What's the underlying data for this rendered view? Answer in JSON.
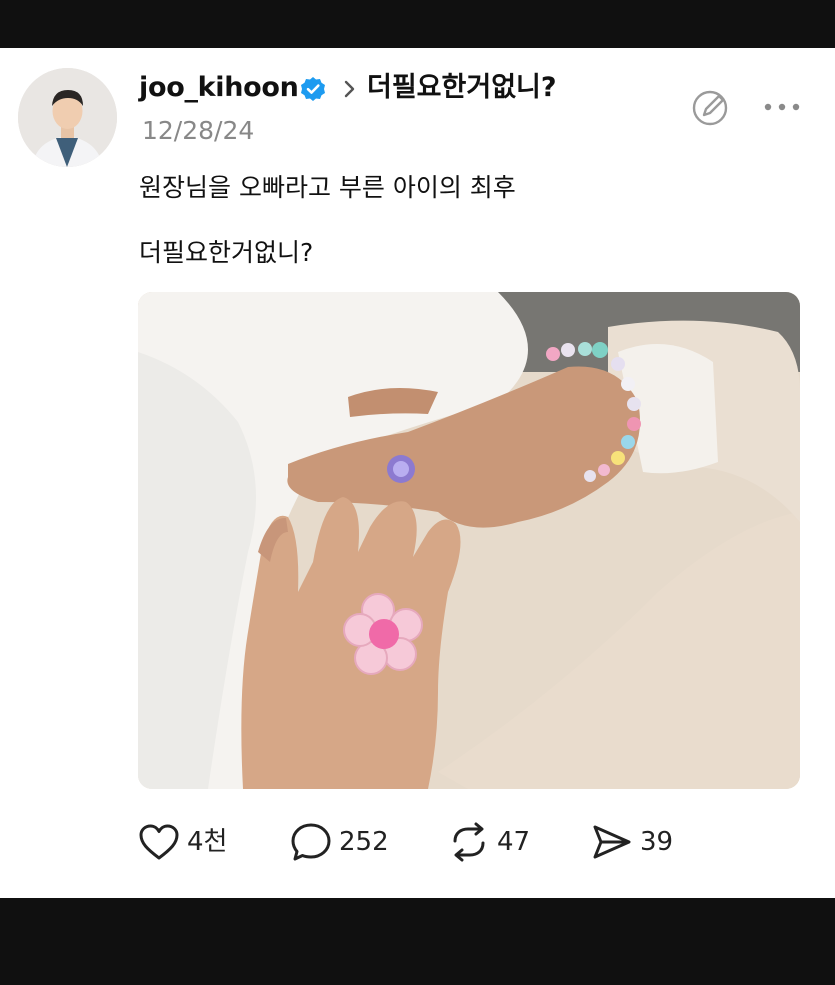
{
  "post": {
    "username": "joo_kihoon",
    "community": "더필요한거없니?",
    "date": "12/28/24",
    "text_line1": "원장님을 오빠라고 부른 아이의 최후",
    "text_line2": "더필요한거없니?"
  },
  "actions": {
    "likes": "4천",
    "replies": "252",
    "reposts": "47",
    "shares": "39"
  },
  "icons": {
    "verified": "verified-badge-icon",
    "chevron": "chevron-right-icon",
    "edit": "edit-compose-icon",
    "more": "more-dots-icon",
    "like": "heart-icon",
    "reply": "speech-bubble-icon",
    "repost": "repost-icon",
    "share": "send-icon"
  },
  "colors": {
    "verified": "#1d9bf0",
    "text": "#111111",
    "muted": "#888888"
  }
}
